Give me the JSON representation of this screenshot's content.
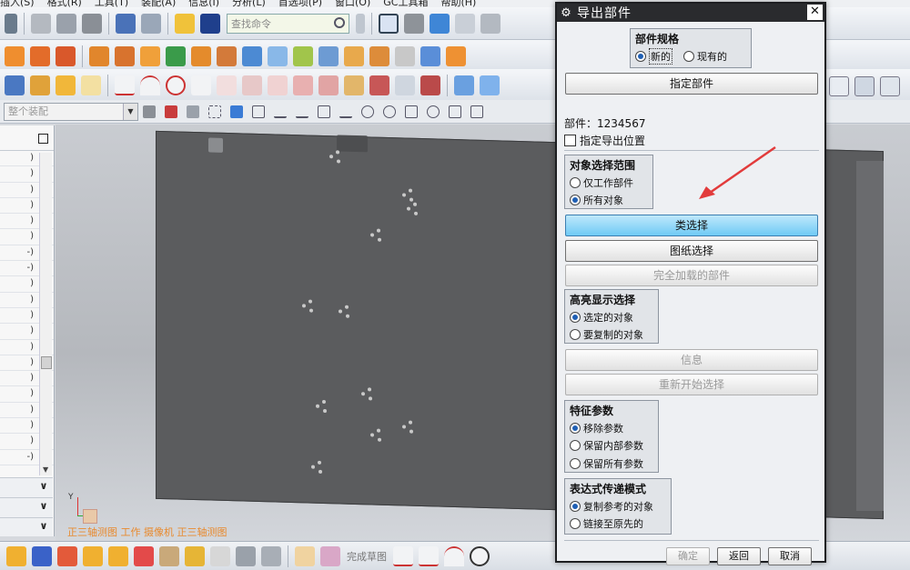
{
  "menubar": {
    "items": [
      "插入(S)",
      "格式(R)",
      "工具(T)",
      "装配(A)",
      "信息(I)",
      "分析(L)",
      "首选项(P)",
      "窗口(O)",
      "GC工具箱",
      "帮助(H)"
    ]
  },
  "toolbar": {
    "search_placeholder": "查找命令"
  },
  "filterbar": {
    "selection_filter": "整个装配"
  },
  "navigator": {
    "rows": [
      ")",
      ")",
      ")",
      ")",
      ")",
      ")",
      "-)",
      "-)",
      ")",
      ")",
      ")",
      ")",
      ")",
      ")",
      ")",
      ")",
      ")",
      ")",
      ")",
      "-)"
    ]
  },
  "viewport": {
    "view_status": "正三轴测图 工作 摄像机 正三轴测图",
    "triad_axis_label": "Y"
  },
  "bottombar": {
    "sketch_label": "完成草图"
  },
  "dialog": {
    "title": "导出部件",
    "part_spec": {
      "title": "部件规格",
      "options": [
        "新的",
        "现有的"
      ],
      "selected": 0
    },
    "specify_part_button": "指定部件",
    "part_label": "部件：",
    "part_number": "1234567",
    "specify_export_location": "指定导出位置",
    "object_scope": {
      "title": "对象选择范围",
      "options": [
        "仅工作部件",
        "所有对象"
      ],
      "selected": 1
    },
    "class_select_button": "类选择",
    "drawing_select_button": "图纸选择",
    "fully_loaded_button": "完全加载的部件",
    "highlight": {
      "title": "高亮显示选择",
      "options": [
        "选定的对象",
        "要复制的对象"
      ],
      "selected": 0
    },
    "info_button": "信息",
    "restart_button": "重新开始选择",
    "feature_params": {
      "title": "特征参数",
      "options": [
        "移除参数",
        "保留内部参数",
        "保留所有参数"
      ],
      "selected": 0
    },
    "expression_mode": {
      "title": "表达式传递模式",
      "options": [
        "复制参考的对象",
        "链接至原先的"
      ],
      "selected": 0
    },
    "footer": {
      "ok": "确定",
      "back": "返回",
      "cancel": "取消"
    }
  },
  "colors": {
    "dialog_title_bg": "#2a2b2e",
    "active_button": "#6fcaf5",
    "plate": "#5b5c5e",
    "arrow": "#e23b3b"
  }
}
